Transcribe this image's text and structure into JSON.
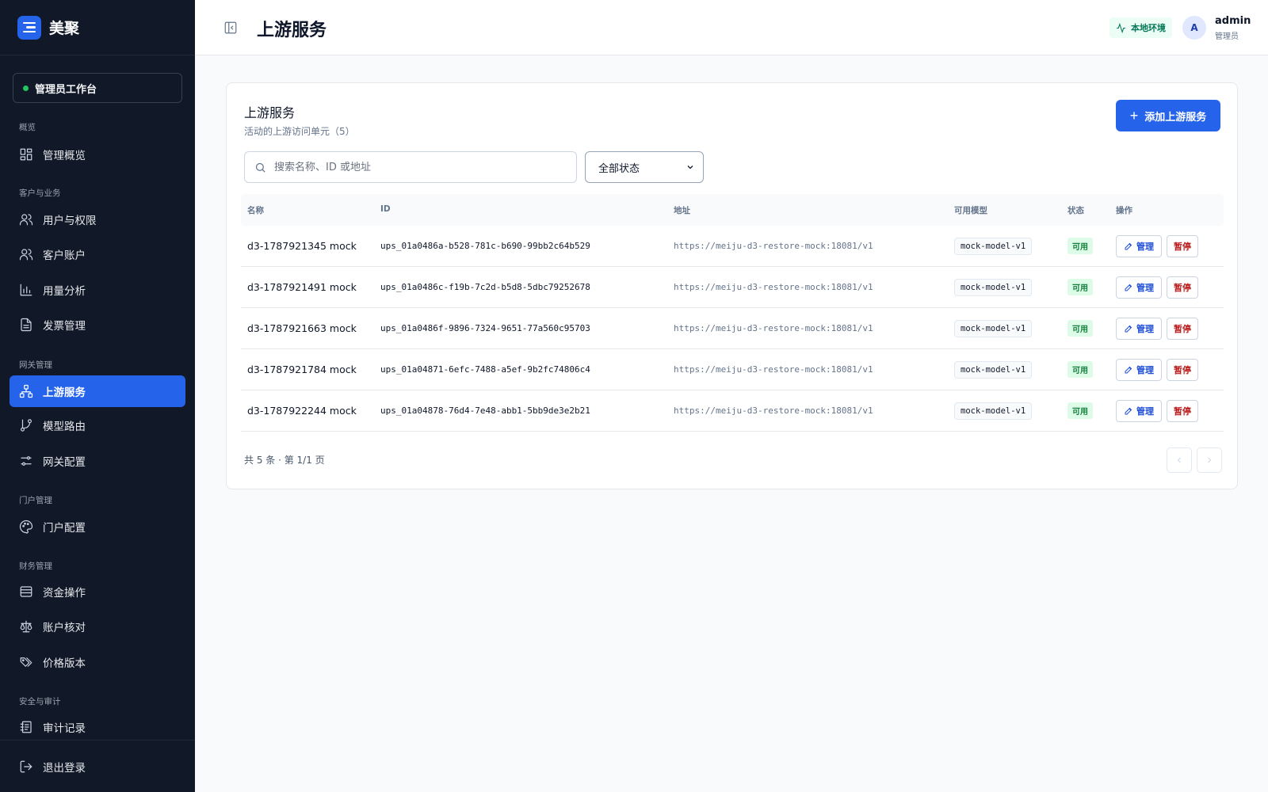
{
  "brand": {
    "name": "美聚"
  },
  "workspace": {
    "label": "管理员工作台"
  },
  "nav": {
    "groups": [
      {
        "label": "概览"
      },
      {
        "label": "客户与业务"
      },
      {
        "label": "网关管理"
      },
      {
        "label": "门户管理"
      },
      {
        "label": "财务管理"
      },
      {
        "label": "安全与审计"
      }
    ],
    "items": [
      {
        "label": "管理概览",
        "icon": "dashboard-icon"
      },
      {
        "label": "用户与权限",
        "icon": "users-icon"
      },
      {
        "label": "客户账户",
        "icon": "customers-icon"
      },
      {
        "label": "用量分析",
        "icon": "bar-chart-icon"
      },
      {
        "label": "发票管理",
        "icon": "invoice-icon"
      },
      {
        "label": "上游服务",
        "icon": "network-icon",
        "active": true
      },
      {
        "label": "模型路由",
        "icon": "git-branch-icon"
      },
      {
        "label": "网关配置",
        "icon": "sliders-icon"
      },
      {
        "label": "门户配置",
        "icon": "palette-icon"
      },
      {
        "label": "资金操作",
        "icon": "wallet-icon"
      },
      {
        "label": "账户核对",
        "icon": "scale-icon"
      },
      {
        "label": "价格版本",
        "icon": "tags-icon"
      },
      {
        "label": "审计记录",
        "icon": "audit-icon"
      }
    ],
    "logout": "退出登录"
  },
  "header": {
    "title": "上游服务",
    "env_badge": "本地环境",
    "user": {
      "initial": "A",
      "name": "admin",
      "role": "管理员"
    }
  },
  "card": {
    "title": "上游服务",
    "subtitle": "活动的上游访问单元（5）",
    "add_button": "添加上游服务",
    "search_placeholder": "搜索名称、ID 或地址",
    "status_filter": "全部状态"
  },
  "table": {
    "columns": [
      "名称",
      "ID",
      "地址",
      "可用模型",
      "状态",
      "操作"
    ],
    "manage_label": "管理",
    "pause_label": "暂停",
    "rows": [
      {
        "name": "d3-1787921345 mock",
        "id": "ups_01a0486a-b528-781c-b690-99bb2c64b529",
        "url": "https://meiju-d3-restore-mock:18081/v1",
        "model": "mock-model-v1",
        "status": "可用"
      },
      {
        "name": "d3-1787921491 mock",
        "id": "ups_01a0486c-f19b-7c2d-b5d8-5dbc79252678",
        "url": "https://meiju-d3-restore-mock:18081/v1",
        "model": "mock-model-v1",
        "status": "可用"
      },
      {
        "name": "d3-1787921663 mock",
        "id": "ups_01a0486f-9896-7324-9651-77a560c95703",
        "url": "https://meiju-d3-restore-mock:18081/v1",
        "model": "mock-model-v1",
        "status": "可用"
      },
      {
        "name": "d3-1787921784 mock",
        "id": "ups_01a04871-6efc-7488-a5ef-9b2fc74806c4",
        "url": "https://meiju-d3-restore-mock:18081/v1",
        "model": "mock-model-v1",
        "status": "可用"
      },
      {
        "name": "d3-1787922244 mock",
        "id": "ups_01a04878-76d4-7e48-abb1-5bb9de3e2b21",
        "url": "https://meiju-d3-restore-mock:18081/v1",
        "model": "mock-model-v1",
        "status": "可用"
      }
    ]
  },
  "pagination": {
    "summary": "共 5 条 · 第 1/1 页"
  },
  "colors": {
    "sidebar_bg": "#111827",
    "accent": "#2563eb",
    "status_ok_bg": "#dcfce7",
    "status_ok_text": "#15803d",
    "danger": "#b91c1c"
  }
}
